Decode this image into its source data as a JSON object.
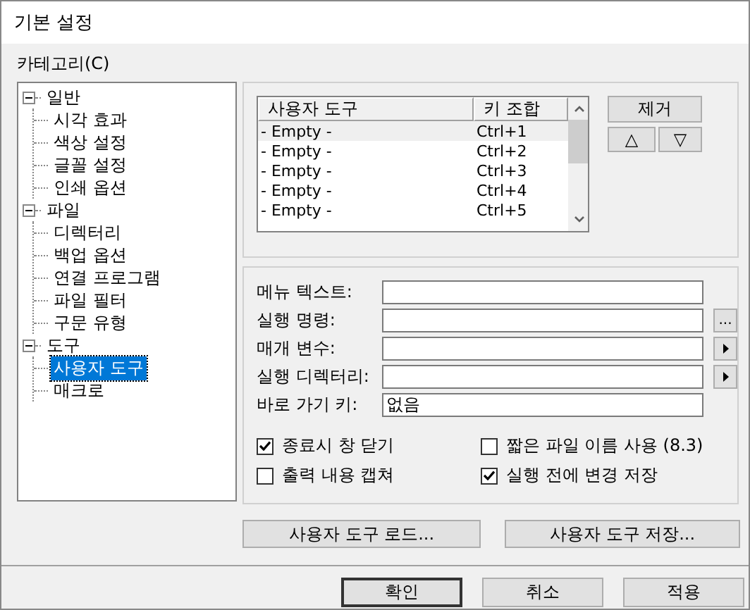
{
  "window": {
    "title": "기본 설정"
  },
  "category_label": "카테고리(C)",
  "tree": [
    {
      "label": "일반",
      "expanded": true,
      "selected": false,
      "children": [
        {
          "label": "시각 효과",
          "selected": false
        },
        {
          "label": "색상 설정",
          "selected": false
        },
        {
          "label": "글꼴 설정",
          "selected": false
        },
        {
          "label": "인쇄 옵션",
          "selected": false
        }
      ]
    },
    {
      "label": "파일",
      "expanded": true,
      "selected": false,
      "children": [
        {
          "label": "디렉터리",
          "selected": false
        },
        {
          "label": "백업 옵션",
          "selected": false
        },
        {
          "label": "연결 프로그램",
          "selected": false
        },
        {
          "label": "파일 필터",
          "selected": false
        },
        {
          "label": "구문 유형",
          "selected": false
        }
      ]
    },
    {
      "label": "도구",
      "expanded": true,
      "selected": false,
      "children": [
        {
          "label": "사용자 도구",
          "selected": true
        },
        {
          "label": "매크로",
          "selected": false
        }
      ]
    }
  ],
  "tools_list": {
    "columns": [
      "사용자 도구",
      "키 조합"
    ],
    "rows": [
      {
        "name": "- Empty -",
        "key": "Ctrl+1",
        "selected": true
      },
      {
        "name": "- Empty -",
        "key": "Ctrl+2",
        "selected": false
      },
      {
        "name": "- Empty -",
        "key": "Ctrl+3",
        "selected": false
      },
      {
        "name": "- Empty -",
        "key": "Ctrl+4",
        "selected": false
      },
      {
        "name": "- Empty -",
        "key": "Ctrl+5",
        "selected": false
      }
    ]
  },
  "remove_button": "제거",
  "move_buttons": [
    "△",
    "▽"
  ],
  "fields": [
    {
      "label": "메뉴 텍스트:",
      "kind": "plain"
    },
    {
      "label": "실행 명령:",
      "kind": "browse",
      "button": "..."
    },
    {
      "label": "매개 변수:",
      "kind": "menu"
    },
    {
      "label": "실행 디렉터리:",
      "kind": "menu"
    },
    {
      "label": "바로 가기 키:",
      "kind": "plain",
      "value": "없음"
    }
  ],
  "options": [
    {
      "label": "종료시 창 닫기",
      "checked": true
    },
    {
      "label": "짧은 파일 이름 사용 (8.3)",
      "checked": false
    },
    {
      "label": "출력 내용 캡쳐",
      "checked": false
    },
    {
      "label": "실행 전에 변경 저장",
      "checked": true
    }
  ],
  "file_buttons": [
    "사용자 도구 로드...",
    "사용자 도구 저장..."
  ],
  "dialog_buttons": [
    {
      "label": "확인",
      "default": true
    },
    {
      "label": "취소",
      "default": false
    },
    {
      "label": "적용",
      "default": false
    }
  ]
}
